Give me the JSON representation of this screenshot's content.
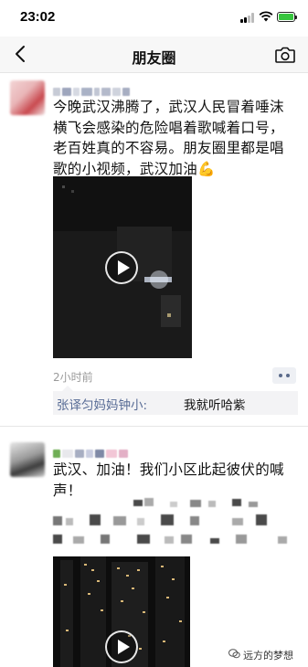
{
  "status_bar": {
    "time": "23:02"
  },
  "nav": {
    "title": "朋友圈"
  },
  "post1": {
    "text": "今晚武汉沸腾了，武汉人民冒着唾沫横飞会感染的危险唱着歌喊着口号，老百姓真的不容易。朋友圈里都是唱歌的小视频，武汉加油💪",
    "timestamp": "2小时前",
    "comment_author": "张译匀妈妈钟小:",
    "comment_text": "我就听哈紫"
  },
  "post2": {
    "text": "武汉、加油！我们小区此起彼伏的喊声！"
  },
  "watermark": {
    "text": "远方的梦想"
  },
  "icons": [
    "back-icon",
    "camera-icon",
    "play-icon",
    "more-icon",
    "wechat-icon"
  ]
}
